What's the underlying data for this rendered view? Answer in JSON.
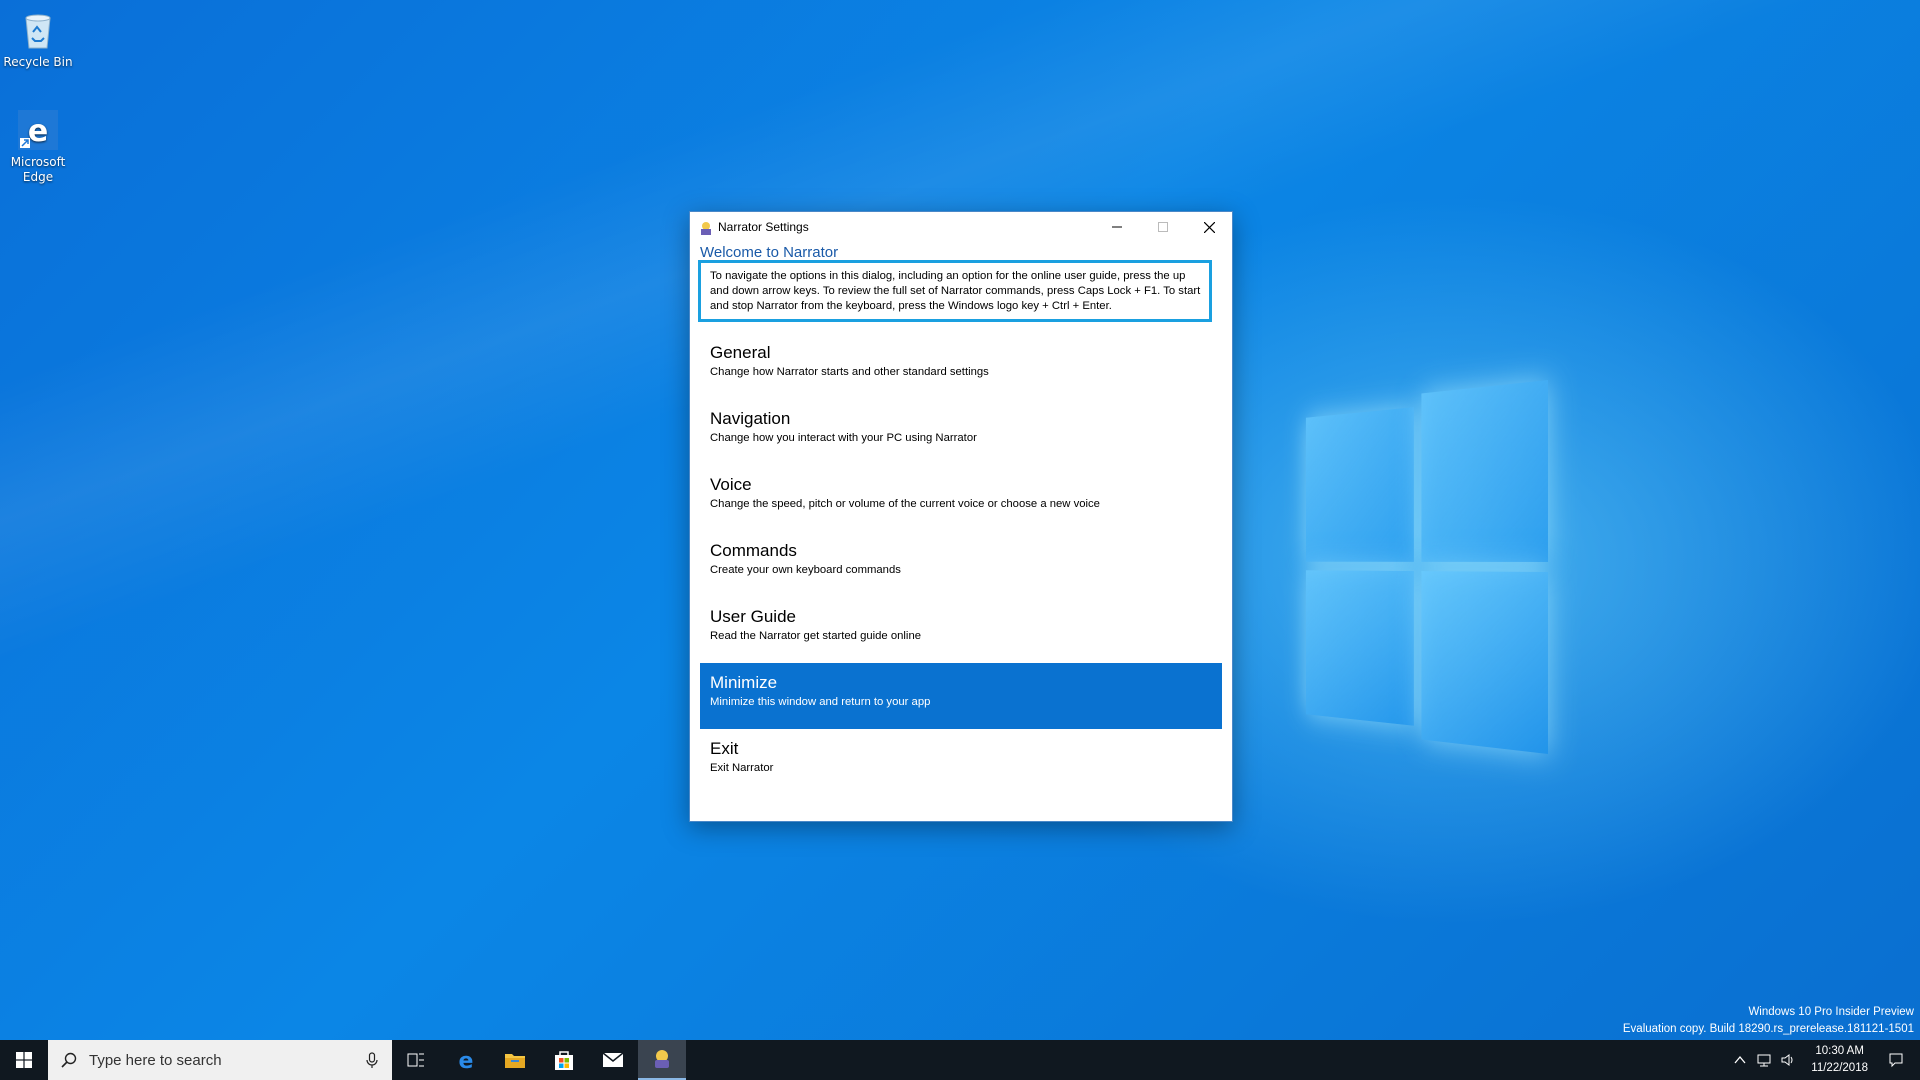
{
  "desktop": {
    "icons": [
      {
        "label": "Recycle Bin",
        "icon": "recycle-bin-icon"
      },
      {
        "label": "Microsoft Edge",
        "icon": "edge-icon"
      }
    ]
  },
  "window": {
    "title": "Narrator Settings",
    "heading": "Welcome to Narrator",
    "intro": "To navigate the options in this dialog, including an option for the online user guide, press the up and down arrow keys. To review the full set of Narrator commands, press Caps Lock + F1. To start and stop Narrator from the keyboard, press the Windows logo key + Ctrl + Enter.",
    "items": [
      {
        "label": "General",
        "desc": "Change how Narrator starts and other standard settings"
      },
      {
        "label": "Navigation",
        "desc": "Change how you interact with your PC using Narrator"
      },
      {
        "label": "Voice",
        "desc": "Change the speed, pitch or volume of the current voice or choose a new voice"
      },
      {
        "label": "Commands",
        "desc": "Create your own keyboard commands"
      },
      {
        "label": "User Guide",
        "desc": "Read the Narrator get started guide online"
      },
      {
        "label": "Minimize",
        "desc": "Minimize this window and return to your app",
        "selected": true
      },
      {
        "label": "Exit",
        "desc": "Exit Narrator"
      }
    ]
  },
  "watermark": {
    "line1": "Windows 10 Pro Insider Preview",
    "line2": "Evaluation copy. Build 18290.rs_prerelease.181121-1501"
  },
  "taskbar": {
    "search_placeholder": "Type here to search",
    "pinned": [
      "task-view-icon",
      "edge-icon",
      "file-explorer-icon",
      "store-icon",
      "mail-icon",
      "narrator-icon"
    ],
    "active": "narrator-icon",
    "time": "10:30 AM",
    "date": "11/22/2018"
  },
  "colors": {
    "selection": "#0a72d0",
    "focus_border": "#1aa0e0",
    "heading": "#1a5aa8",
    "taskbar": "#101820"
  }
}
